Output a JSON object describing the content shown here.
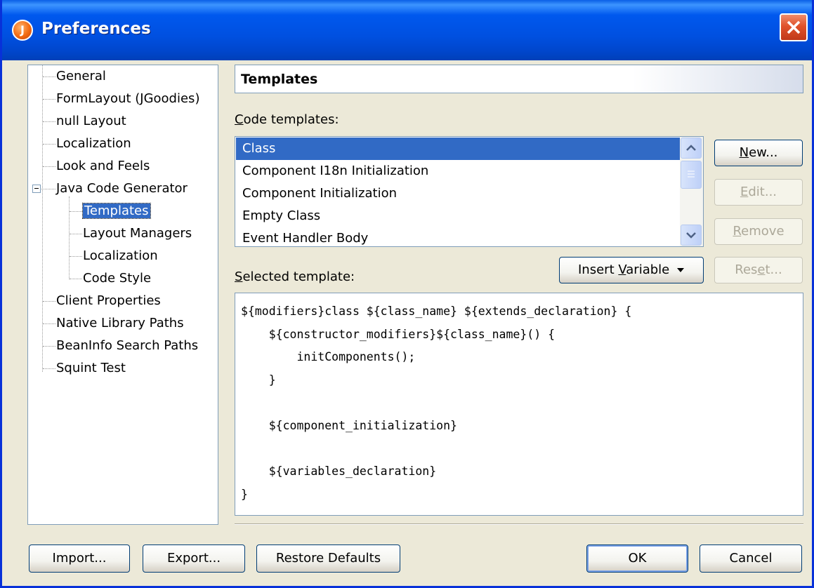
{
  "window": {
    "title": "Preferences",
    "app_icon_letter": "J"
  },
  "tree": {
    "items": [
      {
        "label": "General"
      },
      {
        "label": "FormLayout (JGoodies)"
      },
      {
        "label": "null Layout"
      },
      {
        "label": "Localization"
      },
      {
        "label": "Look and Feels"
      },
      {
        "label": "Java Code Generator"
      },
      {
        "label": "Templates"
      },
      {
        "label": "Layout Managers"
      },
      {
        "label": "Localization"
      },
      {
        "label": "Code Style"
      },
      {
        "label": "Client Properties"
      },
      {
        "label": "Native Library Paths"
      },
      {
        "label": "BeanInfo Search Paths"
      },
      {
        "label": "Squint Test"
      }
    ],
    "selected": "Templates"
  },
  "panel": {
    "header": "Templates",
    "code_templates_label_mnemonic": "C",
    "code_templates_label_rest": "ode templates:",
    "list": [
      "Class",
      "Component I18n Initialization",
      "Component Initialization",
      "Empty Class",
      "Event Handler Body"
    ],
    "selected_template_label_mnemonic": "S",
    "selected_template_label_rest": "elected template:",
    "buttons": {
      "new": {
        "m": "N",
        "rest": "ew..."
      },
      "edit": {
        "m": "E",
        "rest": "dit..."
      },
      "remove": {
        "m": "R",
        "rest": "emove"
      },
      "insert_pre": "Insert ",
      "insert_m": "V",
      "insert_rest": "ariable",
      "reset_pre": "Res",
      "reset_m": "e",
      "reset_rest": "t..."
    },
    "template_text": "${modifiers}class ${class_name} ${extends_declaration} {\n    ${constructor_modifiers}${class_name}() {\n        initComponents();\n    }\n\n    ${component_initialization}\n\n    ${variables_declaration}\n}"
  },
  "footer": {
    "import": "Import...",
    "export": "Export...",
    "restore": "Restore Defaults",
    "ok": "OK",
    "cancel": "Cancel"
  },
  "colors": {
    "titlebar": "#0058EE",
    "selection": "#316AC5",
    "dialog_bg": "#ECE9D8"
  }
}
